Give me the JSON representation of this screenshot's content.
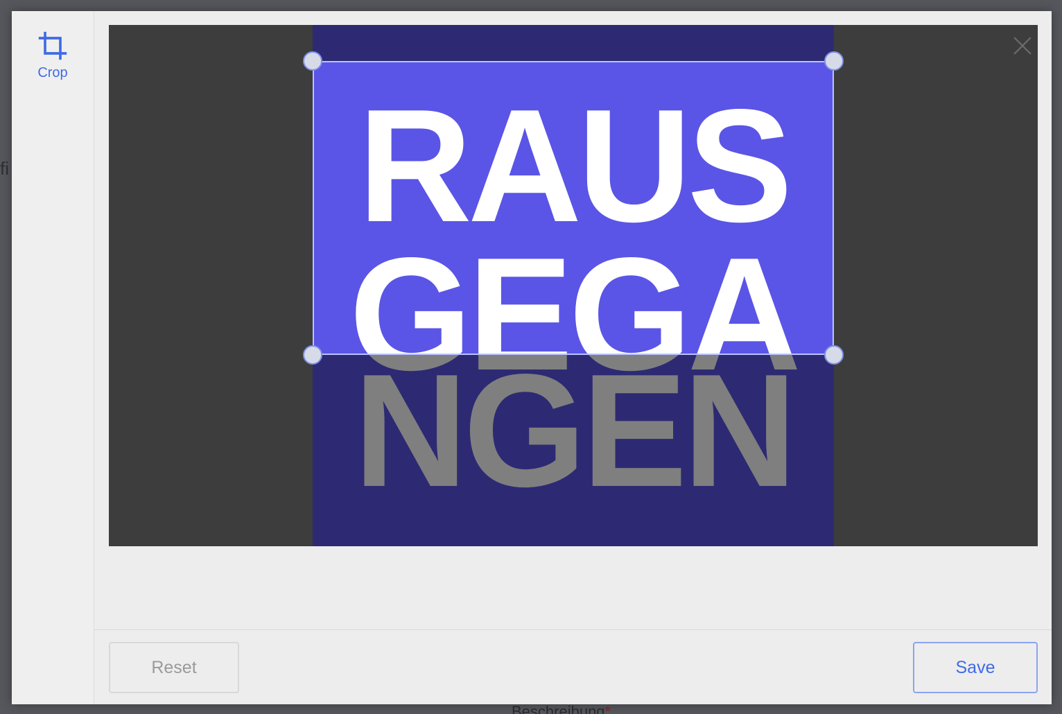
{
  "background": {
    "left_fragment": "fi",
    "bottom_label": "Beschreibung",
    "required_marker": "*"
  },
  "sidebar": {
    "tools": [
      {
        "label": "Crop",
        "icon": "crop-icon",
        "active": true
      }
    ]
  },
  "canvas": {
    "back_icon": "arrow-left-icon",
    "close_icon": "close-icon",
    "image_text": [
      "RAUS",
      "GEGA",
      "NGEN"
    ],
    "image_colors": {
      "background": "#5a55e6",
      "text": "#ffffff"
    }
  },
  "footer": {
    "reset_label": "Reset",
    "save_label": "Save"
  },
  "colors": {
    "accent": "#3f6be6",
    "modal_bg": "#ededed",
    "canvas_bg": "#7a7a7a"
  }
}
